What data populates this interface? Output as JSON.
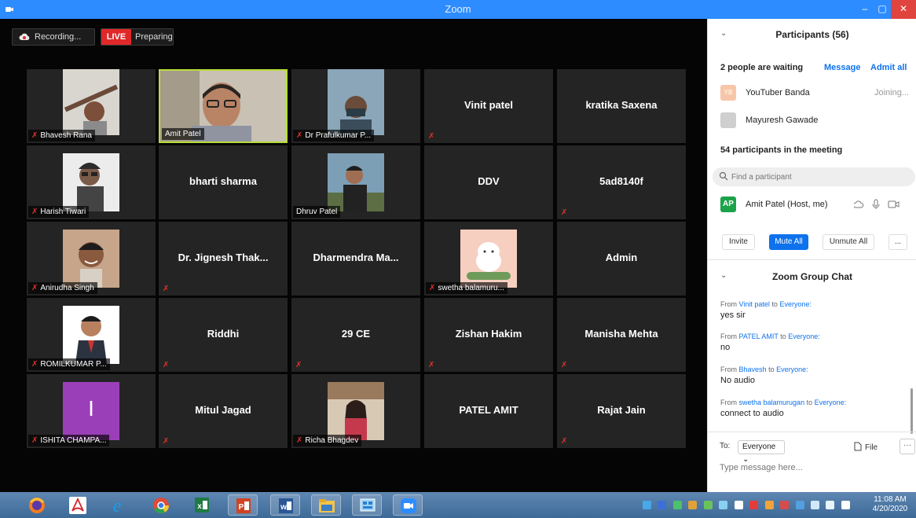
{
  "window": {
    "title": "Zoom",
    "minimize": "–",
    "maximize": "▢",
    "close": "✕"
  },
  "toolbar": {
    "recording": "Recording...",
    "live": "LIVE",
    "preparing": "Preparing"
  },
  "tiles": [
    {
      "label": "Bhavesh Rana",
      "center": "",
      "muted": true,
      "video": true
    },
    {
      "label": "Amit Patel",
      "center": "",
      "muted": false,
      "video": true,
      "active": true
    },
    {
      "label": "Dr Prafulkumar P...",
      "center": "",
      "muted": true,
      "video": true
    },
    {
      "label": "",
      "center": "Vinit patel",
      "muted": true,
      "video": false
    },
    {
      "label": "",
      "center": "kratika Saxena",
      "muted": false,
      "video": false
    },
    {
      "label": "Harish Tiwari",
      "center": "",
      "muted": true,
      "video": true
    },
    {
      "label": "",
      "center": "bharti sharma",
      "muted": false,
      "video": false
    },
    {
      "label": "Dhruv Patel",
      "center": "",
      "muted": false,
      "video": true
    },
    {
      "label": "",
      "center": "DDV",
      "muted": false,
      "video": false
    },
    {
      "label": "",
      "center": "5ad8140f",
      "muted": true,
      "video": false
    },
    {
      "label": "Anirudha Singh",
      "center": "",
      "muted": true,
      "video": true
    },
    {
      "label": "",
      "center": "Dr. Jignesh Thak...",
      "muted": true,
      "video": false
    },
    {
      "label": "",
      "center": "Dharmendra  Ma...",
      "muted": false,
      "video": false
    },
    {
      "label": "swetha balamuru...",
      "center": "",
      "muted": true,
      "video": true
    },
    {
      "label": "",
      "center": "Admin",
      "muted": false,
      "video": false
    },
    {
      "label": "ROMILKUMAR P...",
      "center": "",
      "muted": true,
      "video": true
    },
    {
      "label": "",
      "center": "Riddhi",
      "muted": true,
      "video": false
    },
    {
      "label": "",
      "center": "29 CE",
      "muted": true,
      "video": false
    },
    {
      "label": "",
      "center": "Zishan Hakim",
      "muted": true,
      "video": false
    },
    {
      "label": "",
      "center": "Manisha Mehta",
      "muted": true,
      "video": false
    },
    {
      "label": "ISHITA CHAMPA...",
      "center": "",
      "muted": true,
      "video": true
    },
    {
      "label": "",
      "center": "Mitul Jagad",
      "muted": true,
      "video": false
    },
    {
      "label": "Richa Bhagdev",
      "center": "",
      "muted": true,
      "video": true
    },
    {
      "label": "",
      "center": "PATEL AMIT",
      "muted": false,
      "video": false
    },
    {
      "label": "",
      "center": "Rajat Jain",
      "muted": true,
      "video": false
    }
  ],
  "ishita_initial": "I",
  "participants": {
    "title": "Participants (56)",
    "waiting_label": "2 people are waiting",
    "message_label": "Message",
    "admit_all_label": "Admit all",
    "waiting": [
      {
        "initials": "YB",
        "name": "YouTuber Banda",
        "status": "Joining..."
      },
      {
        "initials": "",
        "name": "Mayuresh Gawade",
        "status": ""
      }
    ],
    "in_meeting_label": "54 participants in the meeting",
    "search_placeholder": "Find a participant",
    "host": {
      "initials": "AP",
      "name": "Amit Patel (Host, me)"
    },
    "buttons": {
      "invite": "Invite",
      "mute_all": "Mute All",
      "unmute_all": "Unmute All",
      "more": "..."
    }
  },
  "chat": {
    "title": "Zoom Group Chat",
    "from_word": "From",
    "to_word": "to",
    "messages": [
      {
        "sender": "Vinit patel",
        "recipient": "Everyone:",
        "text": "yes sir"
      },
      {
        "sender": "PATEL AMIT",
        "recipient": "Everyone:",
        "text": "no"
      },
      {
        "sender": "Bhavesh",
        "recipient": "Everyone:",
        "text": "No audio"
      },
      {
        "sender": "swetha balamurugan",
        "recipient": "Everyone:",
        "text": "connect to audio"
      }
    ],
    "to_label": "To:",
    "to_value": "Everyone ⌄",
    "file_label": "File",
    "more_label": "···",
    "input_placeholder": "Type message here..."
  },
  "taskbar": {
    "time": "11:08 AM",
    "date": "4/20/2020"
  },
  "colors": {
    "zoom_blue": "#2d8cff",
    "active_border": "#b8dd3a",
    "live_red": "#e02828",
    "link_blue": "#0e72ed",
    "host_green": "#1ba34a"
  }
}
